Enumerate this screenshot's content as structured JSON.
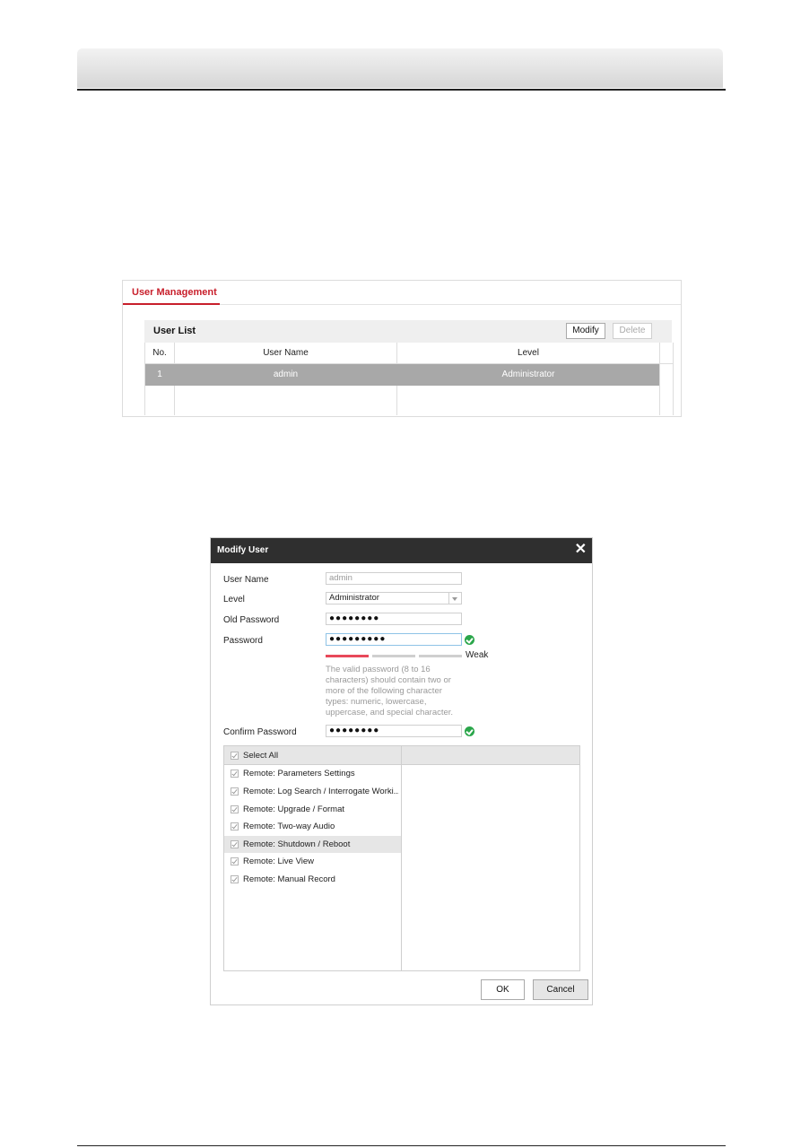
{
  "user_management": {
    "tab_label": "User Management",
    "user_list_title": "User List",
    "modify_label": "Modify",
    "delete_label": "Delete",
    "columns": [
      "No.",
      "User Name",
      "Level"
    ],
    "rows": [
      {
        "no": "1",
        "user_name": "admin",
        "level": "Administrator"
      }
    ]
  },
  "modify_user_dialog": {
    "title": "Modify User",
    "close_glyph": "✕",
    "fields": {
      "user_name_label": "User Name",
      "user_name_value": "admin",
      "level_label": "Level",
      "level_value": "Administrator",
      "old_password_label": "Old Password",
      "old_password_value": "●●●●●●●●",
      "password_label": "Password",
      "password_value": "●●●●●●●●●",
      "confirm_password_label": "Confirm Password",
      "confirm_password_value": "●●●●●●●●"
    },
    "strength_label": "Weak",
    "strength_level": "1 of 3",
    "password_hint": "The valid password (8 to 16 characters) should contain two or more of the following character types: numeric, lowercase, uppercase, and special character.",
    "select_all_label": "Select All",
    "permissions": [
      {
        "label": "Remote: Parameters Settings",
        "checked": true
      },
      {
        "label": "Remote: Log Search / Interrogate Worki...",
        "checked": true
      },
      {
        "label": "Remote: Upgrade / Format",
        "checked": true
      },
      {
        "label": "Remote: Two-way Audio",
        "checked": true
      },
      {
        "label": "Remote: Shutdown / Reboot",
        "checked": true
      },
      {
        "label": "Remote: Live View",
        "checked": true
      },
      {
        "label": "Remote: Manual Record",
        "checked": true
      }
    ],
    "ok_label": "OK",
    "cancel_label": "Cancel"
  },
  "colors": {
    "accent_red": "#c81f2b",
    "selected_row": "#a8a8a8",
    "dialog_titlebar": "#2f2f2f",
    "success_green": "#2aa64a",
    "strength_weak": "#e8495a"
  }
}
